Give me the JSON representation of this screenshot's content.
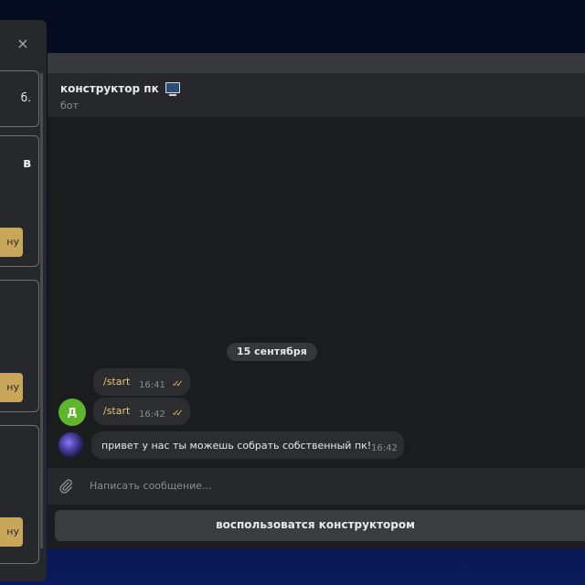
{
  "chat": {
    "title": "конструктор пк",
    "subtitle": "бот",
    "date_divider": "15 сентября",
    "messages": [
      {
        "text": "/start",
        "time": "16:41",
        "status": "✓✓"
      },
      {
        "text": "/start",
        "time": "16:42",
        "status": "✓✓"
      }
    ],
    "bot_message": {
      "text": "привет у нас ты можешь собрать собственный пк!",
      "time": "16:42"
    },
    "user_avatar_letter": "Д",
    "input_placeholder": "Написать сообщение...",
    "keyboard_button": "воспользоватся конструктором"
  },
  "side_panel": {
    "close_icon": "×",
    "cards": [
      {
        "text": "б."
      },
      {
        "text": "в",
        "button": "ну"
      },
      {
        "button": "ну"
      },
      {
        "button": "ну"
      }
    ]
  },
  "colors": {
    "accent": "#c9a75a",
    "check": "#d8b25a",
    "avatar_green": "#5fb52b"
  }
}
